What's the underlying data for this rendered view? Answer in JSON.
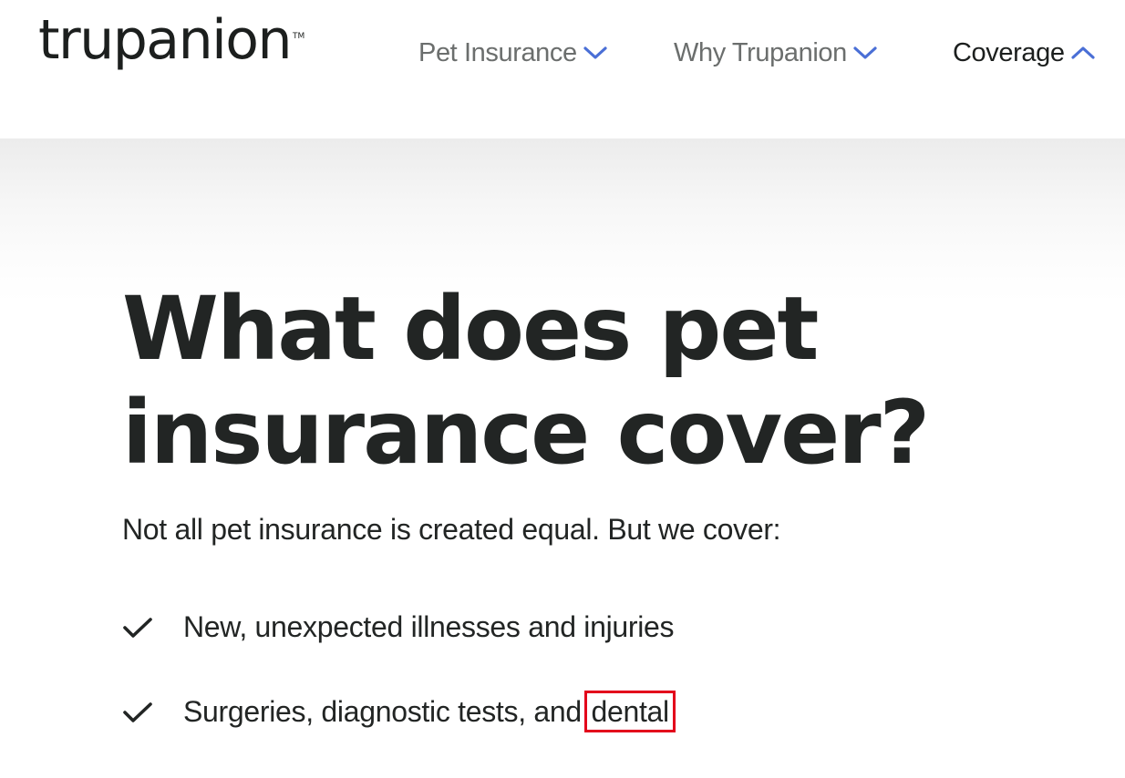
{
  "header": {
    "logo_text": "trupanion",
    "logo_tm": "TM",
    "nav": [
      {
        "label": "Pet Insurance",
        "icon": "chevron-down-icon",
        "active": false
      },
      {
        "label": "Why Trupanion",
        "icon": "chevron-down-icon",
        "active": false
      },
      {
        "label": "Coverage",
        "icon": "chevron-up-icon",
        "active": true
      }
    ]
  },
  "hero": {
    "title_line1": "What does pet",
    "title_line2": "insurance cover?",
    "subtitle": "Not all pet insurance is created equal. But we cover:",
    "items": [
      {
        "text": "New, unexpected illnesses and injuries",
        "icon": "check-icon"
      },
      {
        "text_before": "Surgeries, diagnostic tests, and ",
        "highlight": "dental",
        "icon": "check-icon"
      }
    ]
  },
  "colors": {
    "text": "#222524",
    "nav_muted": "#6b6e6d",
    "chevron": "#4a6fd6",
    "highlight_box": "#e3001b"
  }
}
